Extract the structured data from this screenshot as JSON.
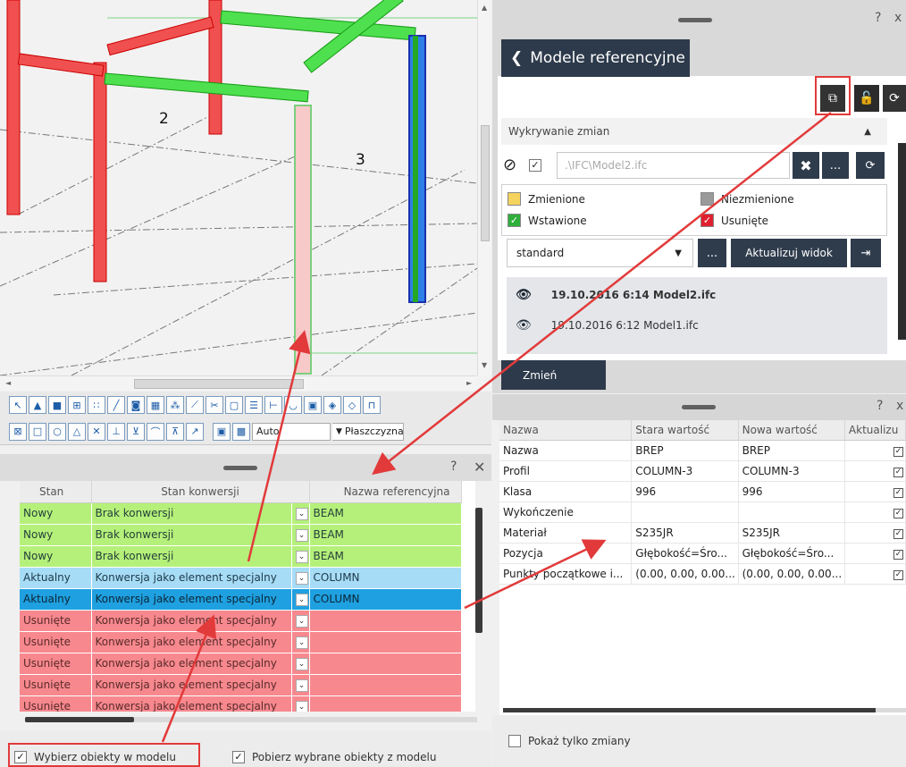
{
  "viewport": {
    "label_2": "2",
    "label_3": "3",
    "combo_auto": "Auto",
    "combo_plane": "Płaszczyzna"
  },
  "left_panel": {
    "columns": [
      "Stan",
      "Stan konwersji",
      "Nazwa referencyjna"
    ],
    "rows": [
      {
        "stan": "Nowy",
        "konwersja": "Brak konwersji",
        "nazwa": "BEAM",
        "kind": "nowy"
      },
      {
        "stan": "Nowy",
        "konwersja": "Brak konwersji",
        "nazwa": "BEAM",
        "kind": "nowy"
      },
      {
        "stan": "Nowy",
        "konwersja": "Brak konwersji",
        "nazwa": "BEAM",
        "kind": "nowy"
      },
      {
        "stan": "Aktualny",
        "konwersja": "Konwersja jako element specjalny",
        "nazwa": "COLUMN",
        "kind": "akt"
      },
      {
        "stan": "Aktualny",
        "konwersja": "Konwersja jako element specjalny",
        "nazwa": "COLUMN",
        "kind": "sel"
      },
      {
        "stan": "Usunięte",
        "konwersja": "Konwersja jako element specjalny",
        "nazwa": "",
        "kind": "usu"
      },
      {
        "stan": "Usunięte",
        "konwersja": "Konwersja jako element specjalny",
        "nazwa": "",
        "kind": "usu"
      },
      {
        "stan": "Usunięte",
        "konwersja": "Konwersja jako element specjalny",
        "nazwa": "",
        "kind": "usu"
      },
      {
        "stan": "Usunięte",
        "konwersja": "Konwersja jako element specjalny",
        "nazwa": "",
        "kind": "usu"
      },
      {
        "stan": "Usunięte",
        "konwersja": "Konwersja jako element specjalny",
        "nazwa": "",
        "kind": "usu"
      }
    ],
    "footer": {
      "select_in_model": "Wybierz obiekty w modelu",
      "fetch_from_model": "Pobierz wybrane obiekty z modelu"
    }
  },
  "right_panel": {
    "back_title": "Modele referencyjne",
    "section_title": "Wykrywanie zmian",
    "path": ".\\IFC\\Model2.ifc",
    "legend": {
      "changed": "Zmienione",
      "unchanged": "Niezmienione",
      "inserted": "Wstawione",
      "deleted": "Usunięte"
    },
    "preset": "standard",
    "ellipsis": "...",
    "update_view": "Aktualizuj widok",
    "history": [
      "19.10.2016 6:14 Model2.ifc",
      "19.10.2016 6:12 Model1.ifc"
    ],
    "change_button": "Zmień",
    "help": "?",
    "close": "x"
  },
  "properties": {
    "columns": [
      "Nazwa",
      "Stara wartość",
      "Nowa wartość",
      "Aktualizu"
    ],
    "rows": [
      {
        "name": "Nazwa",
        "old": "BREP",
        "new": "BREP"
      },
      {
        "name": "Profil",
        "old": "COLUMN-3",
        "new": "COLUMN-3"
      },
      {
        "name": "Klasa",
        "old": "996",
        "new": "996"
      },
      {
        "name": "Wykończenie",
        "old": "",
        "new": ""
      },
      {
        "name": "Materiał",
        "old": "S235JR",
        "new": "S235JR"
      },
      {
        "name": "Pozycja",
        "old": "Głębokość=Śro...",
        "new": "Głębokość=Śro..."
      },
      {
        "name": "Punkty początkowe i...",
        "old": "(0.00, 0.00, 0.00...",
        "new": "(0.00, 0.00, 0.00..."
      }
    ],
    "show_changes_only": "Pokaż tylko zmiany"
  },
  "colors": {
    "changed": "#f4d35e",
    "unchanged": "#9a9a9a",
    "inserted": "#2fae3c",
    "deleted": "#e0202f",
    "highlight": "#e23a3a"
  }
}
